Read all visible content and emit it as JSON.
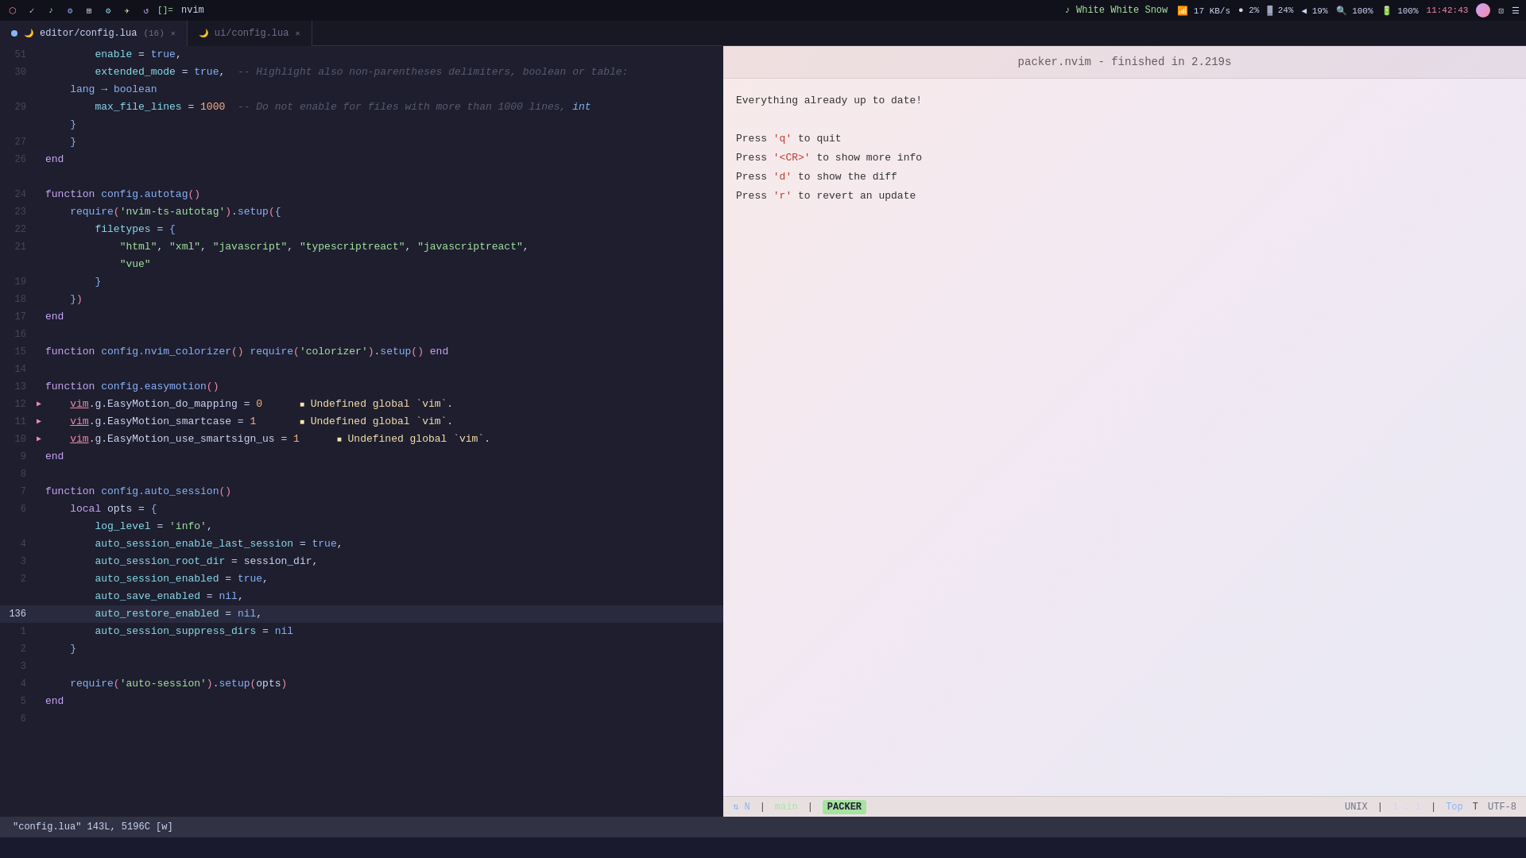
{
  "topbar": {
    "app_name": "nvim",
    "music_label": "White White Snow",
    "network": "17 KB/s",
    "cpu1": "2%",
    "cpu2": "24%",
    "cpu3": "19%",
    "zoom": "100%",
    "battery": "100%",
    "time": "11:42:43"
  },
  "tabs": [
    {
      "id": "tab1",
      "label": "editor/config.lua",
      "badge": "(16)",
      "active": true
    },
    {
      "id": "tab2",
      "label": "ui/config.lua",
      "active": false
    }
  ],
  "code": {
    "lines": [
      {
        "num": "51",
        "content": "        enable = true,"
      },
      {
        "num": "30",
        "content": "        extended_mode = true,  -- Highlight also non-parentheses delimiters, boolean or table:"
      },
      {
        "num": "",
        "content": "    lang → boolean"
      },
      {
        "num": "29",
        "content": "        max_file_lines = 1000  -- Do not enable for files with more than 1000 lines, int"
      },
      {
        "num": "",
        "content": "    }"
      },
      {
        "num": "27",
        "content": "    }"
      },
      {
        "num": "26",
        "content": "end"
      },
      {
        "num": ""
      },
      {
        "num": "24",
        "content": "function config.autotag()"
      },
      {
        "num": "23",
        "content": "    require('nvim-ts-autotag').setup({"
      },
      {
        "num": "22",
        "content": "        filetypes = {"
      },
      {
        "num": "21",
        "content": "            \"html\", \"xml\", \"javascript\", \"typescriptreact\", \"javascriptreact\","
      },
      {
        "num": "",
        "content": "            \"vue\""
      },
      {
        "num": "19",
        "content": "        }"
      },
      {
        "num": "18",
        "content": "    })"
      },
      {
        "num": "17",
        "content": "end"
      },
      {
        "num": "16"
      },
      {
        "num": "15",
        "content": "function config.nvim_colorizer() require('colorizer').setup() end"
      },
      {
        "num": "14"
      },
      {
        "num": "13",
        "content": "function config.easymotion()"
      },
      {
        "num": "12",
        "content": "    vim.g.EasyMotion_do_mapping = 0      ■ Undefined global `vim`.",
        "has_warning": true,
        "warn_at": "vim"
      },
      {
        "num": "11",
        "content": "    vim.g.EasyMotion_smartcase = 1       ■ Undefined global `vim`.",
        "has_warning": true,
        "warn_at": "vim"
      },
      {
        "num": "10",
        "content": "    vim.g.EasyMotion_use_smartsign_us = 1      ■ Undefined global `vim`.",
        "has_warning": true,
        "warn_at": "vim"
      },
      {
        "num": "9",
        "content": "end"
      },
      {
        "num": "8"
      },
      {
        "num": "7",
        "content": "function config.auto_session()"
      },
      {
        "num": "6",
        "content": "    local opts = {"
      },
      {
        "num": "",
        "content": "        log_level = 'info',"
      },
      {
        "num": "4",
        "content": "        auto_session_enable_last_session = true,"
      },
      {
        "num": "3",
        "content": "        auto_session_root_dir = session_dir,"
      },
      {
        "num": "2",
        "content": "        auto_session_enabled = true,"
      },
      {
        "num": "",
        "content": "        auto_save_enabled = nil,"
      },
      {
        "num": "136",
        "content": "        auto_restore_enabled = nil,",
        "current": true
      },
      {
        "num": "1",
        "content": "        auto_session_suppress_dirs = nil"
      },
      {
        "num": "2",
        "content": "    }"
      },
      {
        "num": "3"
      },
      {
        "num": "4",
        "content": "    require('auto-session').setup(opts)"
      },
      {
        "num": "5",
        "content": "end"
      },
      {
        "num": "6"
      }
    ]
  },
  "packer": {
    "header": "packer.nvim - finished in 2.219s",
    "line1": "Everything already up to date!",
    "line2": "",
    "line3": "Press 'q' to quit",
    "line4": "Press '<CR>' to show more info",
    "line5": "Press 'd' to show the diff",
    "line6": "Press 'r' to revert an update"
  },
  "statusbar": {
    "file_info": "\"config.lua\" 143L, 5196C [w]",
    "mode_n": "⇅ N",
    "branch": " main",
    "packer_label": " PACKER",
    "format": "UNIX",
    "position": "1 : 1",
    "scroll": "Top",
    "encoding": "UTF-8"
  }
}
